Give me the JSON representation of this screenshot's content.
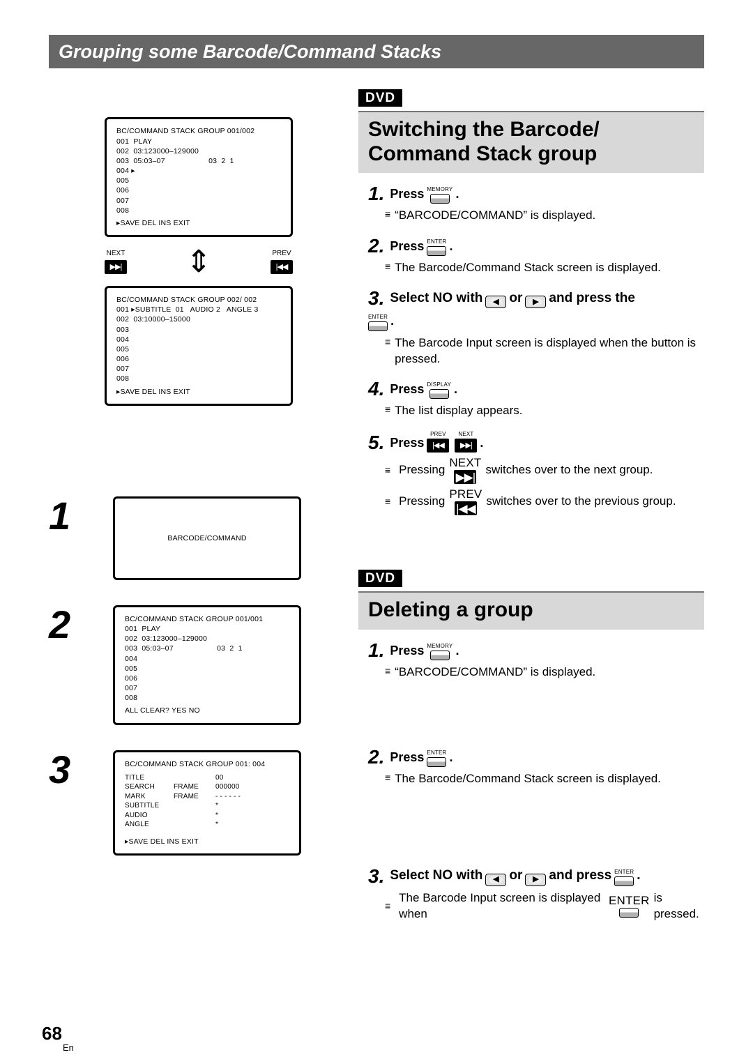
{
  "header": "Grouping some Barcode/Command Stacks",
  "dvd": "DVD",
  "sectionA_title": "Switching the Barcode/\nCommand Stack group",
  "sectionB_title": "Deleting a group",
  "screens": {
    "group1_header": "BC/COMMAND STACK  GROUP  001/002",
    "group1_body": "001  PLAY\n002  03:123000–129000\n003  05:03–07                    03  2  1\n004 ▸\n005\n006\n007\n008",
    "group1_footer": "▸SAVE   DEL    INS    EXIT",
    "group2_header": "BC/COMMAND STACK  GROUP  002/ 002",
    "group2_body": "001 ▸SUBTITLE  01   AUDIO 2   ANGLE 3\n002  03:10000–15000\n003\n004\n005\n006\n007\n008",
    "group2_footer": "▸SAVE   DEL    INS    EXIT",
    "barcode_only": "BARCODE/COMMAND",
    "groupB2_header": "BC/COMMAND STACK  GROUP  001/001",
    "groupB2_body": "001  PLAY\n002  03:123000–129000\n003  05:03–07                    03  2  1\n004\n005\n006\n007\n008",
    "groupB2_footer": "ALL  CLEAR?   YES   NO",
    "groupB3_header": "BC/COMMAND STACK  GROUP  001: 004",
    "groupB3_footer": "▸SAVE   DEL    INS    EXIT",
    "tbl": {
      "title": "TITLE",
      "title_v": "00",
      "search": "SEARCH",
      "search_c": "FRAME",
      "search_v": "000000",
      "mark": "MARK",
      "mark_c": "FRAME",
      "mark_v": "- - - - - -",
      "subtitle": "SUBTITLE",
      "subtitle_v": "*",
      "audio": "AUDIO",
      "audio_v": "*",
      "angle": "ANGLE",
      "angle_v": "*"
    }
  },
  "updown": {
    "next": "NEXT",
    "prev": "PREV"
  },
  "keys": {
    "memory": "MEMORY",
    "enter": "ENTER",
    "display": "DISPLAY",
    "prev": "PREV",
    "next": "NEXT"
  },
  "A": {
    "s1_press": "Press",
    "s1_period": ".",
    "s1_b": "“BARCODE/COMMAND” is displayed.",
    "s2_press": "Press",
    "s2_period": ".",
    "s2_b": "The Barcode/Command Stack screen is displayed.",
    "s3_text1": "Select  NO  with",
    "s3_or": "or",
    "s3_text2": "and press the",
    "s3_period": ".",
    "s3_b": "The Barcode Input screen is displayed when the  button is pressed.",
    "s4_press": "Press",
    "s4_period": ".",
    "s4_b": "The list display appears.",
    "s5_press": "Press",
    "s5_period": ".",
    "s5_b1a": "Pressing",
    "s5_b1b": "switches over to the next group.",
    "s5_b2a": "Pressing",
    "s5_b2b": "switches over to the previous group."
  },
  "B": {
    "s1_press": "Press",
    "s1_period": ".",
    "s1_b": "“BARCODE/COMMAND” is displayed.",
    "s2_press": "Press",
    "s2_period": ".",
    "s2_b": "The Barcode/Command Stack screen is displayed.",
    "s3_text1": "Select  NO  with",
    "s3_or": "or",
    "s3_text2": "and press",
    "s3_period": ".",
    "s3_b1": "The  Barcode  Input  screen  is  displayed  when",
    "s3_b2": "is pressed."
  },
  "nums": {
    "n1": "1",
    "n2": "2",
    "n3": "3"
  },
  "page_num": "68",
  "en": "En"
}
